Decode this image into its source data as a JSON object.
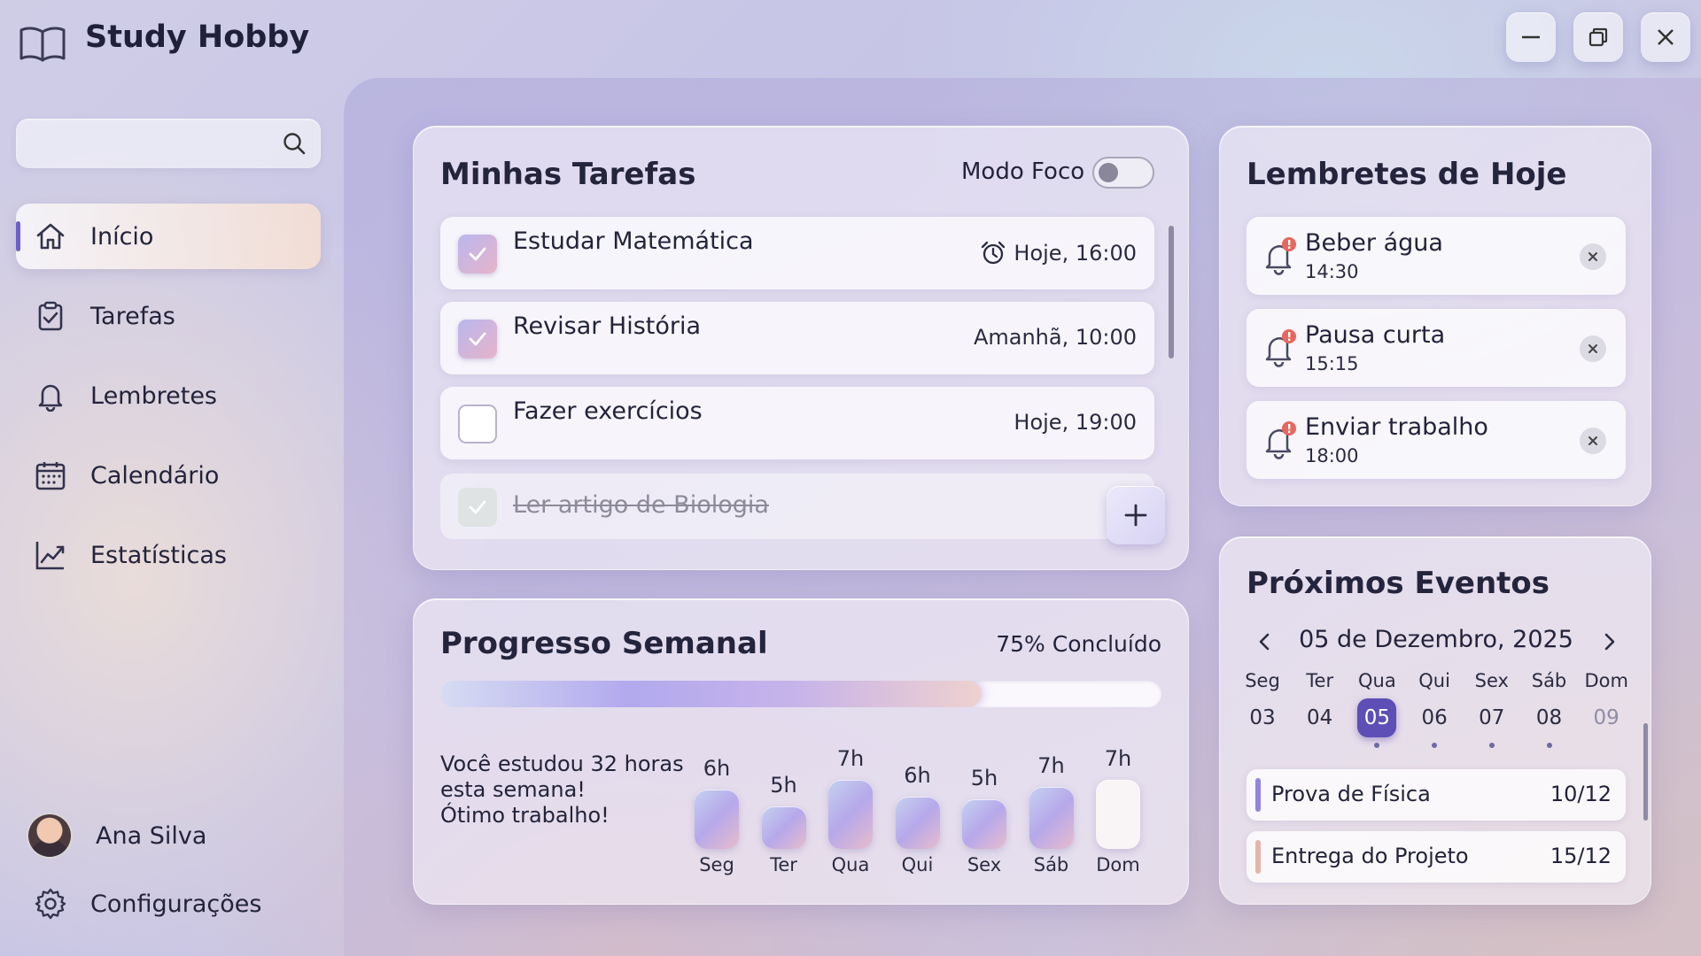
{
  "app": {
    "title": "Study Hobby",
    "logo_icon": "book-icon"
  },
  "window_controls": [
    "minimize-icon",
    "restore-icon",
    "close-icon"
  ],
  "search": {
    "placeholder": "",
    "value": ""
  },
  "sidebar": {
    "items": [
      {
        "label": "Início",
        "icon": "home-icon",
        "active": true
      },
      {
        "label": "Tarefas",
        "icon": "clipboard-check-icon",
        "active": false
      },
      {
        "label": "Lembretes",
        "icon": "bell-icon",
        "active": false
      },
      {
        "label": "Calendário",
        "icon": "calendar-icon",
        "active": false
      },
      {
        "label": "Estatísticas",
        "icon": "chart-line-icon",
        "active": false
      }
    ],
    "user_name": "Ana Silva",
    "settings_label": "Configurações"
  },
  "tasks": {
    "title": "Minhas Tarefas",
    "focus_label": "Modo Foco",
    "focus_on": false,
    "items": [
      {
        "name": "Estudar Matemática",
        "time": "Hoje, 16:00",
        "checked": true,
        "alarm": true,
        "done": false
      },
      {
        "name": "Revisar História",
        "time": "Amanhã, 10:00",
        "checked": true,
        "alarm": false,
        "done": false
      },
      {
        "name": "Fazer exercícios",
        "time": "Hoje, 19:00",
        "checked": false,
        "alarm": false,
        "done": false
      },
      {
        "name": "Ler artigo de Biologia",
        "time": "",
        "checked": true,
        "alarm": false,
        "done": true
      }
    ]
  },
  "reminders": {
    "title": "Lembretes de Hoje",
    "items": [
      {
        "title": "Beber água",
        "time": "14:30"
      },
      {
        "title": "Pausa curta",
        "time": "15:15"
      },
      {
        "title": "Enviar trabalho",
        "time": "18:00"
      }
    ]
  },
  "progress": {
    "title": "Progresso Semanal",
    "percent_label": "75% Concluído",
    "percent": 75,
    "summary_line1": "Você estudou 32 horas",
    "summary_line2": "esta semana!",
    "summary_line3": "Ótimo trabalho!",
    "days": [
      {
        "day": "Seg",
        "label": "6h",
        "hours": 6
      },
      {
        "day": "Ter",
        "label": "5h",
        "hours": 5
      },
      {
        "day": "Qua",
        "label": "7h",
        "hours": 7
      },
      {
        "day": "Qui",
        "label": "6h",
        "hours": 6
      },
      {
        "day": "Sex",
        "label": "5h",
        "hours": 5
      },
      {
        "day": "Sáb",
        "label": "7h",
        "hours": 7
      },
      {
        "day": "Dom",
        "label": "7h",
        "hours": 7,
        "empty": true
      }
    ]
  },
  "events": {
    "title": "Próximos Eventos",
    "month_label": "05 de Dezembro, 2025",
    "weekdays": [
      "Seg",
      "Ter",
      "Qua",
      "Qui",
      "Sex",
      "Sáb",
      "Dom"
    ],
    "days": [
      {
        "num": "03",
        "selected": false,
        "dot": false,
        "muted": false
      },
      {
        "num": "04",
        "selected": false,
        "dot": false,
        "muted": false
      },
      {
        "num": "05",
        "selected": true,
        "dot": true,
        "muted": false
      },
      {
        "num": "06",
        "selected": false,
        "dot": true,
        "muted": false
      },
      {
        "num": "07",
        "selected": false,
        "dot": true,
        "muted": false
      },
      {
        "num": "08",
        "selected": false,
        "dot": true,
        "muted": false
      },
      {
        "num": "09",
        "selected": false,
        "dot": false,
        "muted": true
      }
    ],
    "items": [
      {
        "name": "Prova de Física",
        "date": "10/12",
        "color": "#8f85e0"
      },
      {
        "name": "Entrega do Projeto",
        "date": "15/12",
        "color": "#e5b5a8"
      }
    ]
  },
  "colors": {
    "accent": "#5e4fb6",
    "alert": "#e8665d"
  }
}
